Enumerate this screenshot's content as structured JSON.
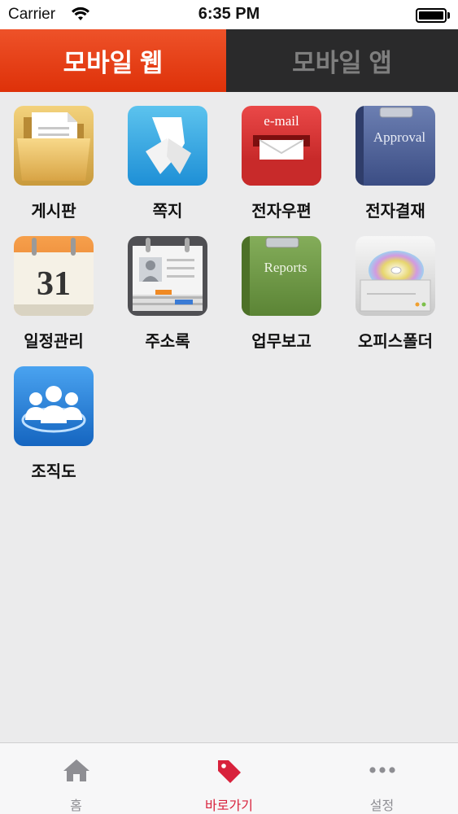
{
  "status_bar": {
    "carrier": "Carrier",
    "time": "6:35 PM"
  },
  "top_tabs": [
    {
      "label": "모바일 웹",
      "active": true
    },
    {
      "label": "모바일 앱",
      "active": false
    }
  ],
  "apps": [
    {
      "label": "게시판",
      "icon": "folder-icon"
    },
    {
      "label": "쪽지",
      "icon": "note-icon"
    },
    {
      "label": "전자우편",
      "icon": "email-icon",
      "icon_text": "e-mail"
    },
    {
      "label": "전자결재",
      "icon": "approval-icon",
      "icon_text": "Approval"
    },
    {
      "label": "일정관리",
      "icon": "calendar-icon",
      "icon_text": "31"
    },
    {
      "label": "주소록",
      "icon": "address-book-icon"
    },
    {
      "label": "업무보고",
      "icon": "reports-icon",
      "icon_text": "Reports"
    },
    {
      "label": "오피스폴더",
      "icon": "disc-drive-icon"
    },
    {
      "label": "조직도",
      "icon": "organization-icon"
    }
  ],
  "tab_bar": [
    {
      "label": "홈",
      "icon": "home-icon",
      "active": false
    },
    {
      "label": "바로가기",
      "icon": "tag-icon",
      "active": true
    },
    {
      "label": "설정",
      "icon": "more-icon",
      "active": false
    }
  ],
  "colors": {
    "accent_red": "#de3109",
    "active_tab": "#d8223c",
    "dark_tab": "#2a2a2b"
  }
}
